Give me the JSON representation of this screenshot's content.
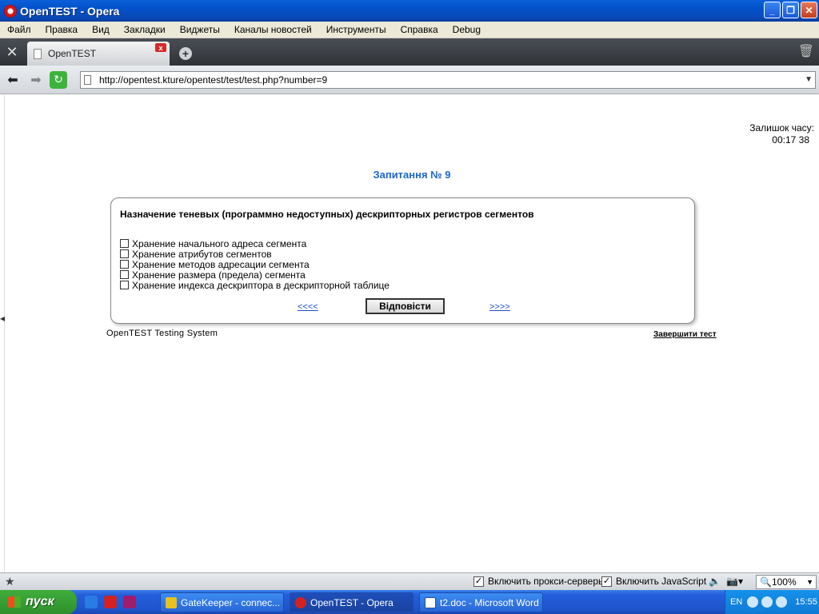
{
  "window": {
    "title": "OpenTEST - Opera"
  },
  "menu": [
    "Файл",
    "Правка",
    "Вид",
    "Закладки",
    "Виджеты",
    "Каналы новостей",
    "Инструменты",
    "Справка",
    "Debug"
  ],
  "tab": {
    "label": "OpenTEST"
  },
  "address": {
    "url": "http://opentest.kture/opentest/test/test.php?number=9"
  },
  "page": {
    "timer_label": "Залишок часу:",
    "timer_value": "00:17 38",
    "question_title": "Запитання № 9",
    "question_text": "Назначение теневых (программно недоступных) дескрипторных регистров сегментов",
    "options": [
      "Хранение начального адреса сегмента",
      "Хранение атрибутов сегментов",
      "Хранение методов адресации сегмента",
      "Хранение размера (предела) сегмента",
      "Хранение индекса дескриптора в дескрипторной таблице"
    ],
    "prev_link": "<<<<",
    "next_link": ">>>>",
    "answer_button": "Відповісти",
    "footer_left": "OpenTEST Testing System",
    "footer_right": "Завершити тест"
  },
  "statusbar": {
    "proxy_label": "Включить прокси-серверы",
    "proxy_checked": true,
    "js_label": "Включить JavaScript",
    "js_checked": true,
    "zoom": "100%"
  },
  "taskbar": {
    "start": "пуск",
    "tasks": [
      "GateKeeper - connec...",
      "OpenTEST - Opera",
      "t2.doc - Microsoft Word"
    ],
    "lang": "EN",
    "clock": "15:55"
  },
  "colors": {
    "question_title": "#1a66cc",
    "link": "#1a4fcc",
    "titlebar": "#0a5fd8"
  },
  "icons": [
    "opera-icon",
    "minimize-icon",
    "maximize-icon",
    "close-icon",
    "tools-icon",
    "page-icon",
    "tab-close-icon",
    "new-tab-icon",
    "trash-icon",
    "back-icon",
    "forward-icon",
    "reload-icon",
    "star-icon"
  ]
}
